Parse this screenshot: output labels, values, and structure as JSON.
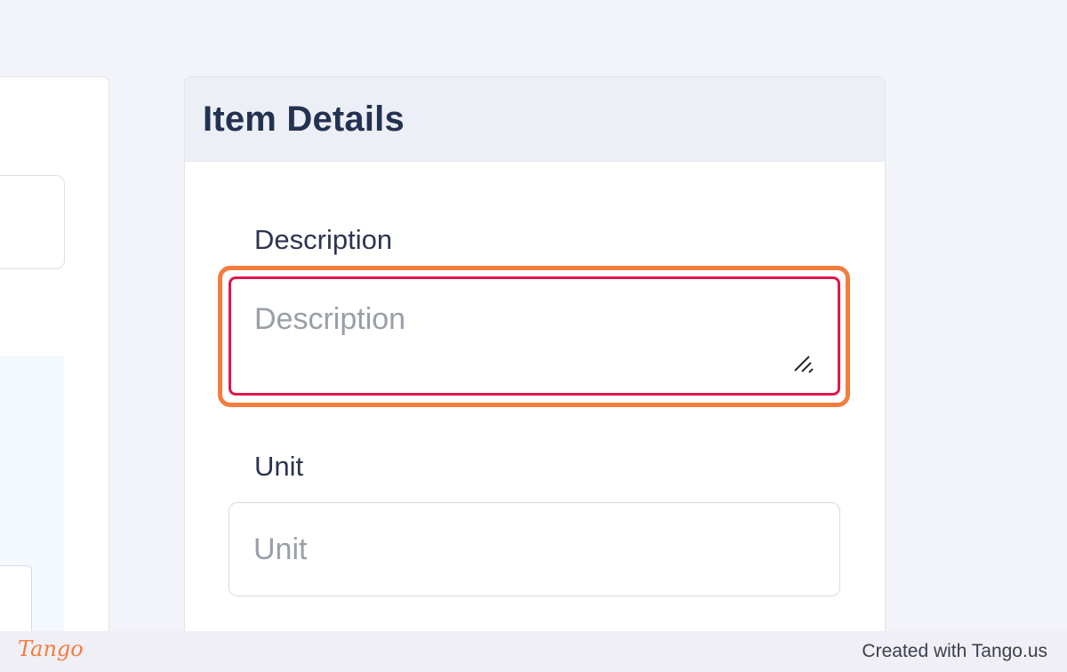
{
  "card": {
    "title": "Item Details"
  },
  "fields": {
    "description": {
      "label": "Description",
      "placeholder": "Description",
      "value": ""
    },
    "unit": {
      "label": "Unit",
      "placeholder": "Unit",
      "value": ""
    }
  },
  "footer": {
    "logo_text": "Tango",
    "credit": "Created with Tango.us"
  },
  "colors": {
    "highlight": "#f47c3c",
    "error_border": "#e0164a",
    "heading": "#233251",
    "header_bg": "#eceff6",
    "page_bg": "#f3f4f9"
  }
}
